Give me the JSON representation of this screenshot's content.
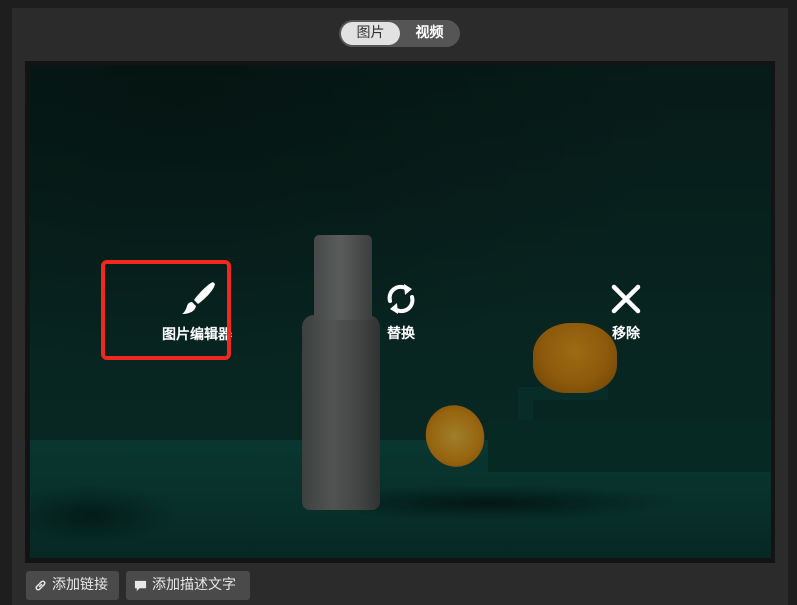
{
  "media_tabs": [
    {
      "label": "图片",
      "active": true
    },
    {
      "label": "视频",
      "active": false
    }
  ],
  "overlay_actions": {
    "edit": {
      "label": "图片编辑器",
      "icon": "brush-icon"
    },
    "replace": {
      "label": "替换",
      "icon": "refresh-icon"
    },
    "remove": {
      "label": "移除",
      "icon": "close-icon"
    }
  },
  "bottom_buttons": {
    "add_link": {
      "label": "添加链接",
      "icon": "link-icon"
    },
    "add_description": {
      "label": "添加描述文字",
      "icon": "comment-icon"
    }
  },
  "colors": {
    "highlight": "#f0281f",
    "active_tab_bg": "#e2e2e2",
    "button_bg": "#4a4a4a"
  }
}
